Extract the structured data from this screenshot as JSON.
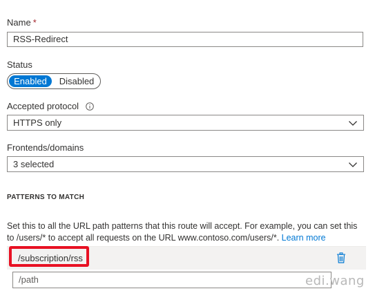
{
  "name": {
    "label": "Name",
    "required_marker": "*",
    "value": "RSS-Redirect"
  },
  "status": {
    "label": "Status",
    "options": [
      "Enabled",
      "Disabled"
    ],
    "selected": "Enabled"
  },
  "accepted_protocol": {
    "label": "Accepted protocol",
    "info_icon": "info-icon",
    "value": "HTTPS only"
  },
  "frontends": {
    "label": "Frontends/domains",
    "value": "3 selected"
  },
  "patterns": {
    "section_title": "PATTERNS TO MATCH",
    "help_text": "Set this to all the URL path patterns that this route will accept. For example, you can set this to /users/* to accept all requests on the URL www.contoso.com/users/*.",
    "learn_more": "Learn more",
    "items": [
      "/subscription/rss"
    ],
    "delete_icon": "trash-icon",
    "new_placeholder": "/path"
  },
  "watermark": "edi.wang",
  "colors": {
    "accent": "#0078d4",
    "highlight": "#e81123",
    "required": "#a4262c"
  }
}
